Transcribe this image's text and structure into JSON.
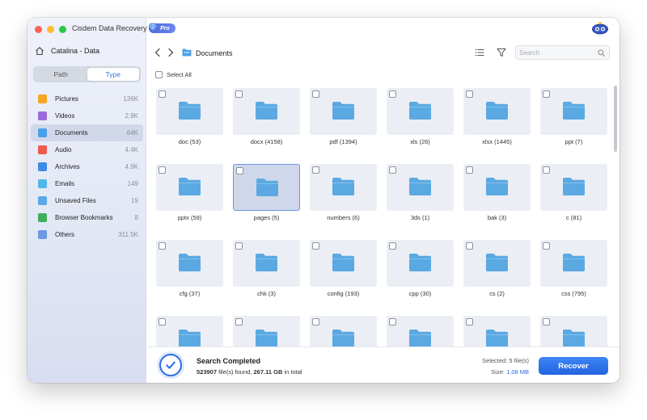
{
  "window": {
    "title": "Cisdem Data Recovery",
    "badge": "Pro"
  },
  "sidebar": {
    "drive": "Catalina - Data",
    "mode_tabs": [
      {
        "label": "Path",
        "active": false
      },
      {
        "label": "Type",
        "active": true
      }
    ],
    "categories": [
      {
        "label": "Pictures",
        "count": "136K",
        "icon": "pictures-icon",
        "color": "#f5a623"
      },
      {
        "label": "Videos",
        "count": "2.9K",
        "icon": "videos-icon",
        "color": "#9b6bdc"
      },
      {
        "label": "Documents",
        "count": "64K",
        "icon": "documents-icon",
        "color": "#4a9fe8",
        "active": true
      },
      {
        "label": "Audio",
        "count": "4.4K",
        "icon": "audio-icon",
        "color": "#ef5a4f"
      },
      {
        "label": "Archives",
        "count": "4.9K",
        "icon": "archives-icon",
        "color": "#3d8be6"
      },
      {
        "label": "Emails",
        "count": "149",
        "icon": "emails-icon",
        "color": "#55b6ea"
      },
      {
        "label": "Unsaved Files",
        "count": "19",
        "icon": "unsaved-files-icon",
        "color": "#5aa8e8"
      },
      {
        "label": "Browser Bookmarks",
        "count": "8",
        "icon": "bookmarks-icon",
        "color": "#3fae5a"
      },
      {
        "label": "Others",
        "count": "311.5K",
        "icon": "others-icon",
        "color": "#6e9ae2"
      }
    ]
  },
  "toolbar": {
    "breadcrumb": "Documents",
    "search_placeholder": "Search",
    "select_all_label": "Select All"
  },
  "grid": {
    "folder_color": "#5aa9e2",
    "items": [
      {
        "label": "doc (53)"
      },
      {
        "label": "docx (4158)"
      },
      {
        "label": "pdf (1394)"
      },
      {
        "label": "xls (26)"
      },
      {
        "label": "xlsx (1445)"
      },
      {
        "label": "ppt (7)"
      },
      {
        "label": "pptx (59)"
      },
      {
        "label": "pages (5)",
        "selected": true
      },
      {
        "label": "numbers (6)"
      },
      {
        "label": "3ds (1)"
      },
      {
        "label": "bak (3)"
      },
      {
        "label": "c (81)"
      },
      {
        "label": "cfg (37)"
      },
      {
        "label": "chk (3)"
      },
      {
        "label": "config (193)"
      },
      {
        "label": "cpp (30)"
      },
      {
        "label": "cs (2)"
      },
      {
        "label": "css (795)"
      },
      {
        "label": ""
      },
      {
        "label": ""
      },
      {
        "label": ""
      },
      {
        "label": ""
      },
      {
        "label": ""
      },
      {
        "label": ""
      }
    ]
  },
  "status": {
    "title": "Search Completed",
    "files_found": "523907",
    "files_found_suffix": "file(s) found,",
    "total_size": "267.11 GB",
    "total_suffix": "in total",
    "selected_label": "Selected:",
    "selected_value": "5 file(s)",
    "size_label": "Size:",
    "size_value": "1.08 MB",
    "recover_label": "Recover",
    "accent": "#2a6ce8"
  }
}
